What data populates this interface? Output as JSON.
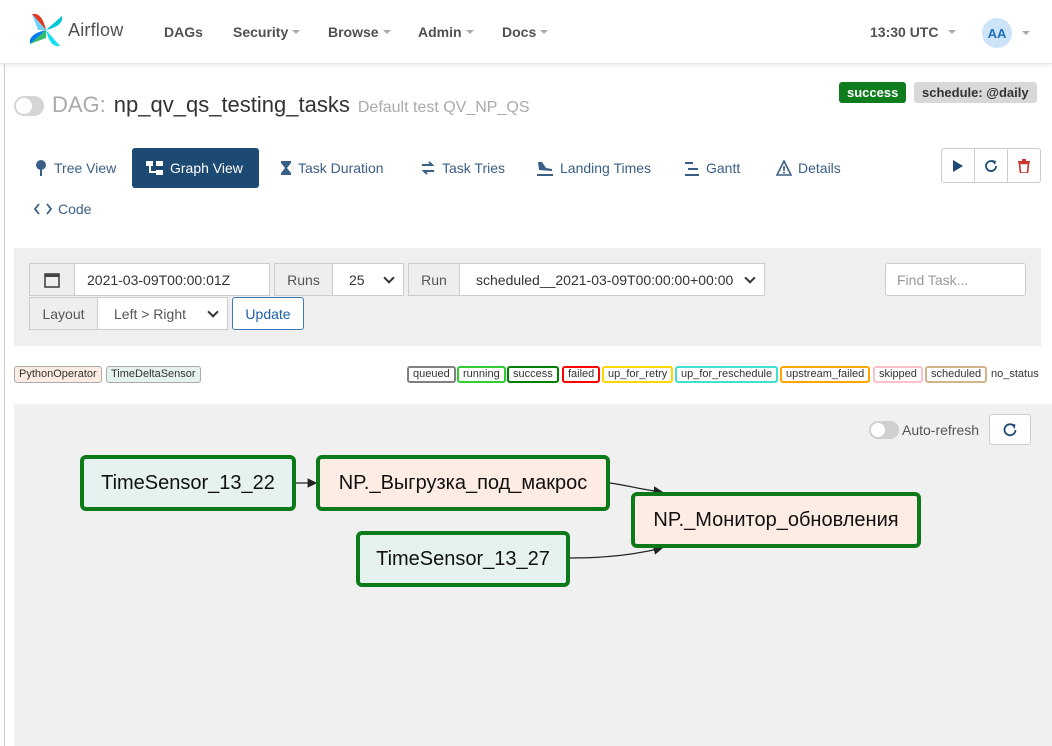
{
  "app": {
    "brand": "Airflow",
    "nav": [
      {
        "label": "DAGs",
        "dropdown": false
      },
      {
        "label": "Security",
        "dropdown": true
      },
      {
        "label": "Browse",
        "dropdown": true
      },
      {
        "label": "Admin",
        "dropdown": true
      },
      {
        "label": "Docs",
        "dropdown": true
      }
    ],
    "time": "13:30 UTC",
    "user_initials": "AA"
  },
  "dag": {
    "prefix": "DAG:",
    "name": "np_qv_qs_testing_tasks",
    "description": "Default test QV_NP_QS",
    "status_badge": "success",
    "schedule_badge": "schedule: @daily"
  },
  "tabs": [
    {
      "label": "Tree View",
      "icon": "tree-icon",
      "active": false
    },
    {
      "label": "Graph View",
      "icon": "graph-icon",
      "active": true
    },
    {
      "label": "Task Duration",
      "icon": "hourglass-icon",
      "active": false
    },
    {
      "label": "Task Tries",
      "icon": "tries-icon",
      "active": false
    },
    {
      "label": "Landing Times",
      "icon": "landing-icon",
      "active": false
    },
    {
      "label": "Gantt",
      "icon": "gantt-icon",
      "active": false
    },
    {
      "label": "Details",
      "icon": "details-icon",
      "active": false
    },
    {
      "label": "Code",
      "icon": "code-icon",
      "active": false
    }
  ],
  "controls": {
    "date": "2021-03-09T00:00:01Z",
    "runs_label": "Runs",
    "runs_value": "25",
    "run_label": "Run",
    "run_value": "scheduled__2021-03-09T00:00:00+00:00",
    "layout_label": "Layout",
    "layout_value": "Left > Right",
    "update_label": "Update",
    "find_placeholder": "Find Task..."
  },
  "legend": {
    "operators": [
      {
        "label": "PythonOperator",
        "color": "#fdece3"
      },
      {
        "label": "TimeDeltaSensor",
        "color": "#e5f2f0"
      }
    ],
    "states": [
      {
        "label": "queued",
        "color": "#808080"
      },
      {
        "label": "running",
        "color": "#32cd32"
      },
      {
        "label": "success",
        "color": "#008000"
      },
      {
        "label": "failed",
        "color": "#ff0000"
      },
      {
        "label": "up_for_retry",
        "color": "#ffd700"
      },
      {
        "label": "up_for_reschedule",
        "color": "#40e0d0"
      },
      {
        "label": "upstream_failed",
        "color": "#ffa500"
      },
      {
        "label": "skipped",
        "color": "#ffc0cb"
      },
      {
        "label": "scheduled",
        "color": "#d2b48c"
      }
    ],
    "no_status": "no_status"
  },
  "graph": {
    "auto_refresh_label": "Auto-refresh",
    "nodes": [
      {
        "id": "n1",
        "label": "TimeSensor_13_22",
        "kind": "sensor"
      },
      {
        "id": "n2",
        "label": "NP._Выгрузка_под_макрос",
        "kind": "python"
      },
      {
        "id": "n3",
        "label": "NP._Монитор_обновления",
        "kind": "python"
      },
      {
        "id": "n4",
        "label": "TimeSensor_13_27",
        "kind": "sensor"
      }
    ],
    "success_color": "#0d7a1a"
  }
}
